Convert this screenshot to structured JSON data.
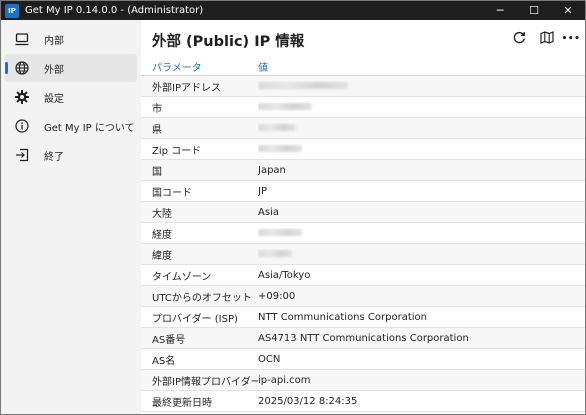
{
  "window": {
    "app_icon_text": "IP",
    "title": "Get My IP   0.14.0.0 - (Administrator)",
    "controls": {
      "minimize": "─",
      "maximize": "☐",
      "close": "✕"
    }
  },
  "sidebar": {
    "items": [
      {
        "label": "内部",
        "icon": "computer-icon"
      },
      {
        "label": "外部",
        "icon": "globe-icon"
      },
      {
        "label": "設定",
        "icon": "gear-icon"
      },
      {
        "label": "Get My IP について",
        "icon": "info-icon"
      },
      {
        "label": "終了",
        "icon": "exit-icon"
      }
    ],
    "active_index": 1
  },
  "main": {
    "title": "外部 (Public) IP 情報",
    "toolbar": {
      "refresh_icon": "refresh-icon",
      "map_icon": "map-icon",
      "more_icon": "more-icon",
      "more_label": "•••"
    },
    "table": {
      "headers": {
        "key": "パラメータ",
        "value": "値"
      },
      "rows": [
        {
          "key": "外部IPアドレス",
          "value": "",
          "redacted": true
        },
        {
          "key": "市",
          "value": "",
          "redacted": true
        },
        {
          "key": "県",
          "value": "",
          "redacted": true
        },
        {
          "key": "Zip コード",
          "value": "",
          "redacted": true
        },
        {
          "key": "国",
          "value": "Japan"
        },
        {
          "key": "国コード",
          "value": "JP"
        },
        {
          "key": "大陸",
          "value": "Asia"
        },
        {
          "key": "経度",
          "value": "",
          "redacted": true
        },
        {
          "key": "緯度",
          "value": "",
          "redacted": true
        },
        {
          "key": "タイムゾーン",
          "value": "Asia/Tokyo"
        },
        {
          "key": "UTCからのオフセット",
          "value": "+09:00"
        },
        {
          "key": "プロバイダー (ISP)",
          "value": "NTT Communications Corporation"
        },
        {
          "key": "AS番号",
          "value": "AS4713 NTT Communications Corporation"
        },
        {
          "key": "AS名",
          "value": "OCN"
        },
        {
          "key": "外部IP情報プロバイダー",
          "value": "ip-api.com"
        },
        {
          "key": "最終更新日時",
          "value": "2025/03/12 8:24:35"
        }
      ]
    }
  },
  "colors": {
    "accent": "#1a73c9",
    "titlebar": "#1e1e1e",
    "sidebar_bg": "#f3f3f3"
  }
}
